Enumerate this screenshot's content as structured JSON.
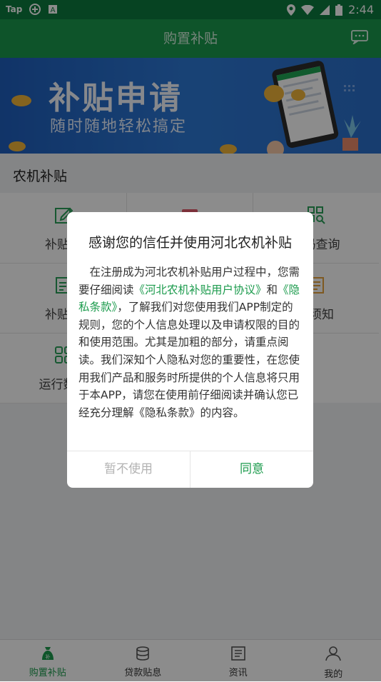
{
  "status_bar": {
    "left_text": "Tap",
    "time": "2:44"
  },
  "app_bar": {
    "title": "购置补贴",
    "message_icon": "chat-bubble-icon"
  },
  "banner": {
    "headline": "补贴申请",
    "subline": "随时随地轻松搞定"
  },
  "section": {
    "title": "农机补贴"
  },
  "grid": {
    "items": [
      {
        "label": "补贴申",
        "icon": "edit-icon"
      },
      {
        "label": "",
        "icon": "id-card-icon"
      },
      {
        "label": "维码查询",
        "icon": "qr-search-icon"
      },
      {
        "label": "补贴公",
        "icon": "notice-icon"
      },
      {
        "label": "",
        "icon": "doc-icon"
      },
      {
        "label": "理须知",
        "icon": "book-icon"
      },
      {
        "label": "运行数据",
        "icon": "grid-icon"
      }
    ]
  },
  "dialog": {
    "title": "感谢您的信任并使用河北农机补贴",
    "body_part1": "在注册成为河北农机补贴用户过程中，您需要仔细阅读",
    "agreement_link": "《河北农机补贴用户协议》",
    "body_part2": "和",
    "privacy_link": "《隐私条款》",
    "body_part3": "，了解我们对您使用我们APP制定的规则，您的个人信息处理以及申请权限的目的和使用范围。尤其是加粗的部分，请重点阅读。我们深知个人隐私对您的重要性，在您使用我们产品和服务时所提供的个人信息将只用于本APP，请您在使用前仔细阅读并确认您已经充分理解《隐私条款》的内容。",
    "decline": "暂不使用",
    "accept": "同意"
  },
  "tab_bar": {
    "tabs": [
      {
        "label": "购置补贴",
        "icon": "money-bag-icon"
      },
      {
        "label": "贷款贴息",
        "icon": "coin-stack-icon"
      },
      {
        "label": "资讯",
        "icon": "newspaper-icon"
      },
      {
        "label": "我的",
        "icon": "person-icon"
      }
    ]
  }
}
